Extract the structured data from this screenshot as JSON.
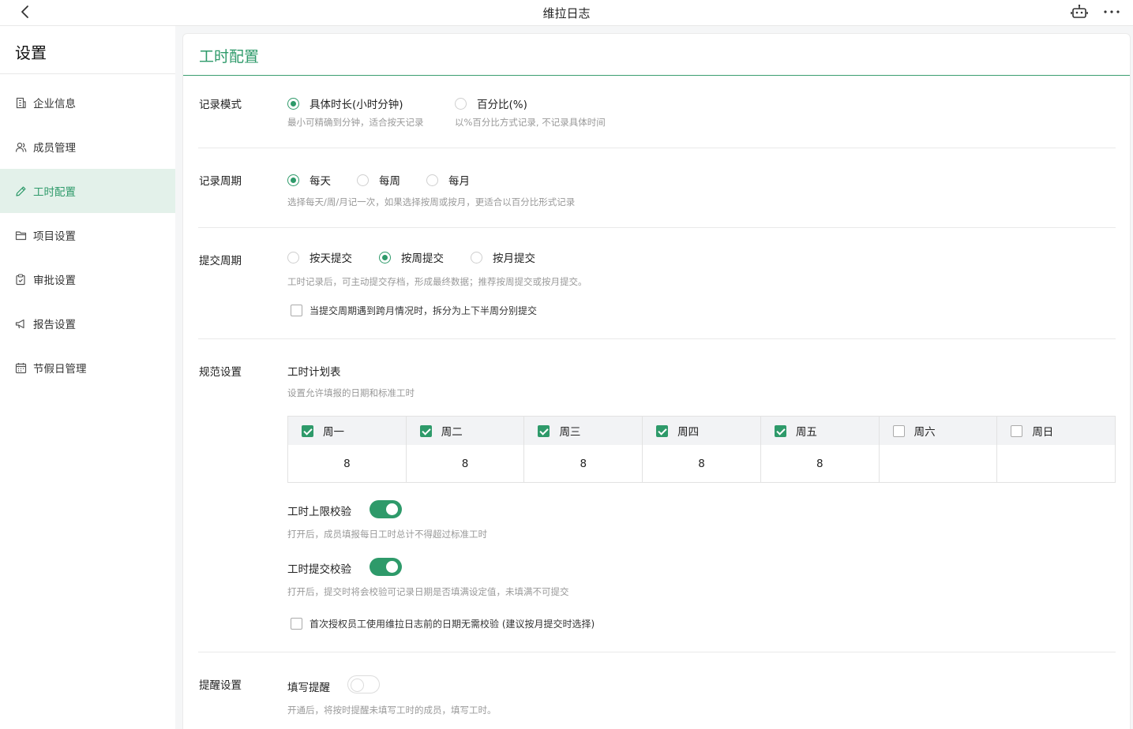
{
  "header": {
    "title": "维拉日志"
  },
  "sidebar": {
    "title": "设置",
    "items": [
      {
        "label": "企业信息",
        "icon": "building-icon"
      },
      {
        "label": "成员管理",
        "icon": "users-icon"
      },
      {
        "label": "工时配置",
        "icon": "pencil-icon",
        "active": true
      },
      {
        "label": "项目设置",
        "icon": "folder-icon"
      },
      {
        "label": "审批设置",
        "icon": "approval-icon"
      },
      {
        "label": "报告设置",
        "icon": "megaphone-icon"
      },
      {
        "label": "节假日管理",
        "icon": "calendar-icon"
      }
    ]
  },
  "page": {
    "title": "工时配置",
    "record_mode": {
      "label": "记录模式",
      "options": [
        {
          "label": "具体时长(小时分钟)",
          "hint": "最小可精确到分钟，适合按天记录",
          "selected": true
        },
        {
          "label": "百分比(%)",
          "hint": "以%百分比方式记录, 不记录具体时间",
          "selected": false
        }
      ]
    },
    "record_cycle": {
      "label": "记录周期",
      "options": [
        {
          "label": "每天",
          "selected": true
        },
        {
          "label": "每周",
          "selected": false
        },
        {
          "label": "每月",
          "selected": false
        }
      ],
      "hint": "选择每天/周/月记一次，如果选择按周或按月，更适合以百分比形式记录"
    },
    "submit_cycle": {
      "label": "提交周期",
      "options": [
        {
          "label": "按天提交",
          "selected": false
        },
        {
          "label": "按周提交",
          "selected": true
        },
        {
          "label": "按月提交",
          "selected": false
        }
      ],
      "hint": "工时记录后，可主动提交存档，形成最终数据；推荐按周提交或按月提交。",
      "split_checkbox": "当提交周期遇到跨月情况时，拆分为上下半周分别提交"
    },
    "norms": {
      "label": "规范设置",
      "plan_title": "工时计划表",
      "plan_hint": "设置允许填报的日期和标准工时",
      "days": [
        {
          "label": "周一",
          "checked": true,
          "hours": "8"
        },
        {
          "label": "周二",
          "checked": true,
          "hours": "8"
        },
        {
          "label": "周三",
          "checked": true,
          "hours": "8"
        },
        {
          "label": "周四",
          "checked": true,
          "hours": "8"
        },
        {
          "label": "周五",
          "checked": true,
          "hours": "8"
        },
        {
          "label": "周六",
          "checked": false,
          "hours": ""
        },
        {
          "label": "周日",
          "checked": false,
          "hours": ""
        }
      ],
      "upper_limit": {
        "label": "工时上限校验",
        "on": true,
        "hint": "打开后，成员填报每日工时总计不得超过标准工时"
      },
      "submit_check": {
        "label": "工时提交校验",
        "on": true,
        "hint": "打开后，提交时将会校验可记录日期是否填满设定值，未填满不可提交"
      },
      "first_auth_checkbox": "首次授权员工使用维拉日志前的日期无需校验 (建议按月提交时选择)"
    },
    "reminder": {
      "label": "提醒设置",
      "fill_label": "填写提醒",
      "on": false,
      "hint": "开通后，将按时提醒未填写工时的成员，填写工时。"
    }
  },
  "colors": {
    "accent": "#2e9a6a",
    "active_bg": "#e3f1ea"
  }
}
